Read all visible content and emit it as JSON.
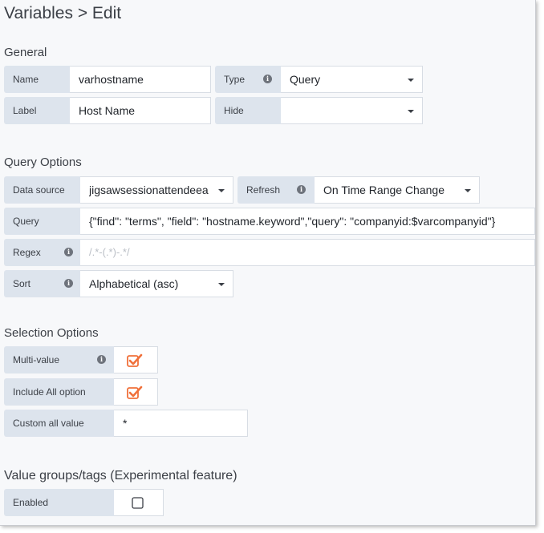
{
  "page": {
    "title": "Variables > Edit"
  },
  "general": {
    "heading": "General",
    "name_label": "Name",
    "name_value": "varhostname",
    "type_label": "Type",
    "type_value": "Query",
    "label_label": "Label",
    "label_value": "Host Name",
    "hide_label": "Hide",
    "hide_value": ""
  },
  "query_options": {
    "heading": "Query Options",
    "datasource_label": "Data source",
    "datasource_value": "jigsawsessionattendeea",
    "refresh_label": "Refresh",
    "refresh_value": "On Time Range Change",
    "query_label": "Query",
    "query_value": "{\"find\": \"terms\", \"field\": \"hostname.keyword\",\"query\": \"companyid:$varcompanyid\"}",
    "regex_label": "Regex",
    "regex_placeholder": "/.*-(.*)-.*/",
    "sort_label": "Sort",
    "sort_value": "Alphabetical (asc)"
  },
  "selection_options": {
    "heading": "Selection Options",
    "multivalue_label": "Multi-value",
    "multivalue_checked": true,
    "includeall_label": "Include All option",
    "includeall_checked": true,
    "customall_label": "Custom all value",
    "customall_value": "*"
  },
  "value_groups": {
    "heading": "Value groups/tags (Experimental feature)",
    "enabled_label": "Enabled",
    "enabled_checked": false
  },
  "colors": {
    "accent": "#f0703a",
    "label_bg": "#dde4ed",
    "panel_bg": "#f7f8fa"
  },
  "icons": {
    "info": "info-icon",
    "caret": "caret-down-icon",
    "check": "checkmark-icon"
  }
}
